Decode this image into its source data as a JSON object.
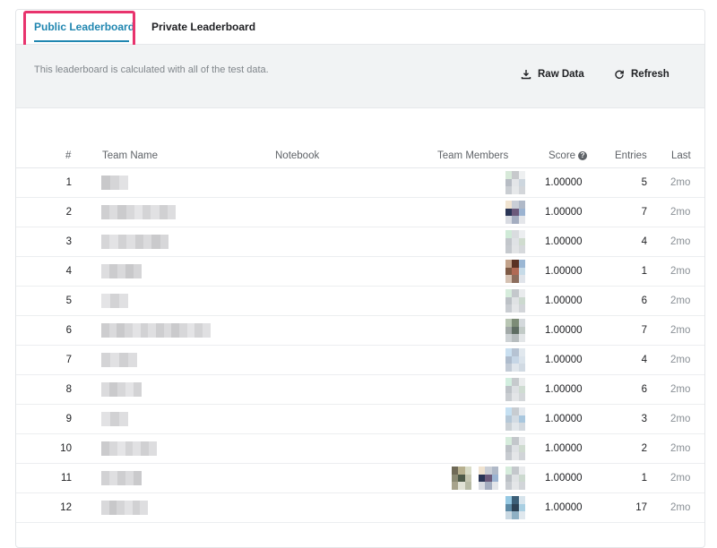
{
  "tabs": [
    {
      "label": "Public Leaderboard",
      "active": true
    },
    {
      "label": "Private Leaderboard",
      "active": false
    }
  ],
  "info": {
    "text": "This leaderboard is calculated with all of the test data.",
    "raw_data_label": "Raw Data",
    "refresh_label": "Refresh"
  },
  "table": {
    "headers": {
      "rank": "#",
      "team_name": "Team Name",
      "notebook": "Notebook",
      "team_members": "Team Members",
      "score": "Score",
      "entries": "Entries",
      "last": "Last"
    },
    "rows": [
      {
        "rank": "1",
        "score": "1.00000",
        "entries": "5",
        "last": "2mo"
      },
      {
        "rank": "2",
        "score": "1.00000",
        "entries": "7",
        "last": "2mo"
      },
      {
        "rank": "3",
        "score": "1.00000",
        "entries": "4",
        "last": "2mo"
      },
      {
        "rank": "4",
        "score": "1.00000",
        "entries": "1",
        "last": "2mo"
      },
      {
        "rank": "5",
        "score": "1.00000",
        "entries": "6",
        "last": "2mo"
      },
      {
        "rank": "6",
        "score": "1.00000",
        "entries": "7",
        "last": "2mo"
      },
      {
        "rank": "7",
        "score": "1.00000",
        "entries": "4",
        "last": "2mo"
      },
      {
        "rank": "8",
        "score": "1.00000",
        "entries": "6",
        "last": "2mo"
      },
      {
        "rank": "9",
        "score": "1.00000",
        "entries": "3",
        "last": "2mo"
      },
      {
        "rank": "10",
        "score": "1.00000",
        "entries": "2",
        "last": "2mo"
      },
      {
        "rank": "11",
        "score": "1.00000",
        "entries": "1",
        "last": "2mo"
      },
      {
        "rank": "12",
        "score": "1.00000",
        "entries": "17",
        "last": "2mo"
      }
    ]
  },
  "icons": {
    "download": "download-icon",
    "refresh": "refresh-icon",
    "help": "help-icon"
  },
  "colors": {
    "accent": "#2086b0",
    "highlight": "#e8336d",
    "infobar": "#f1f3f4"
  }
}
